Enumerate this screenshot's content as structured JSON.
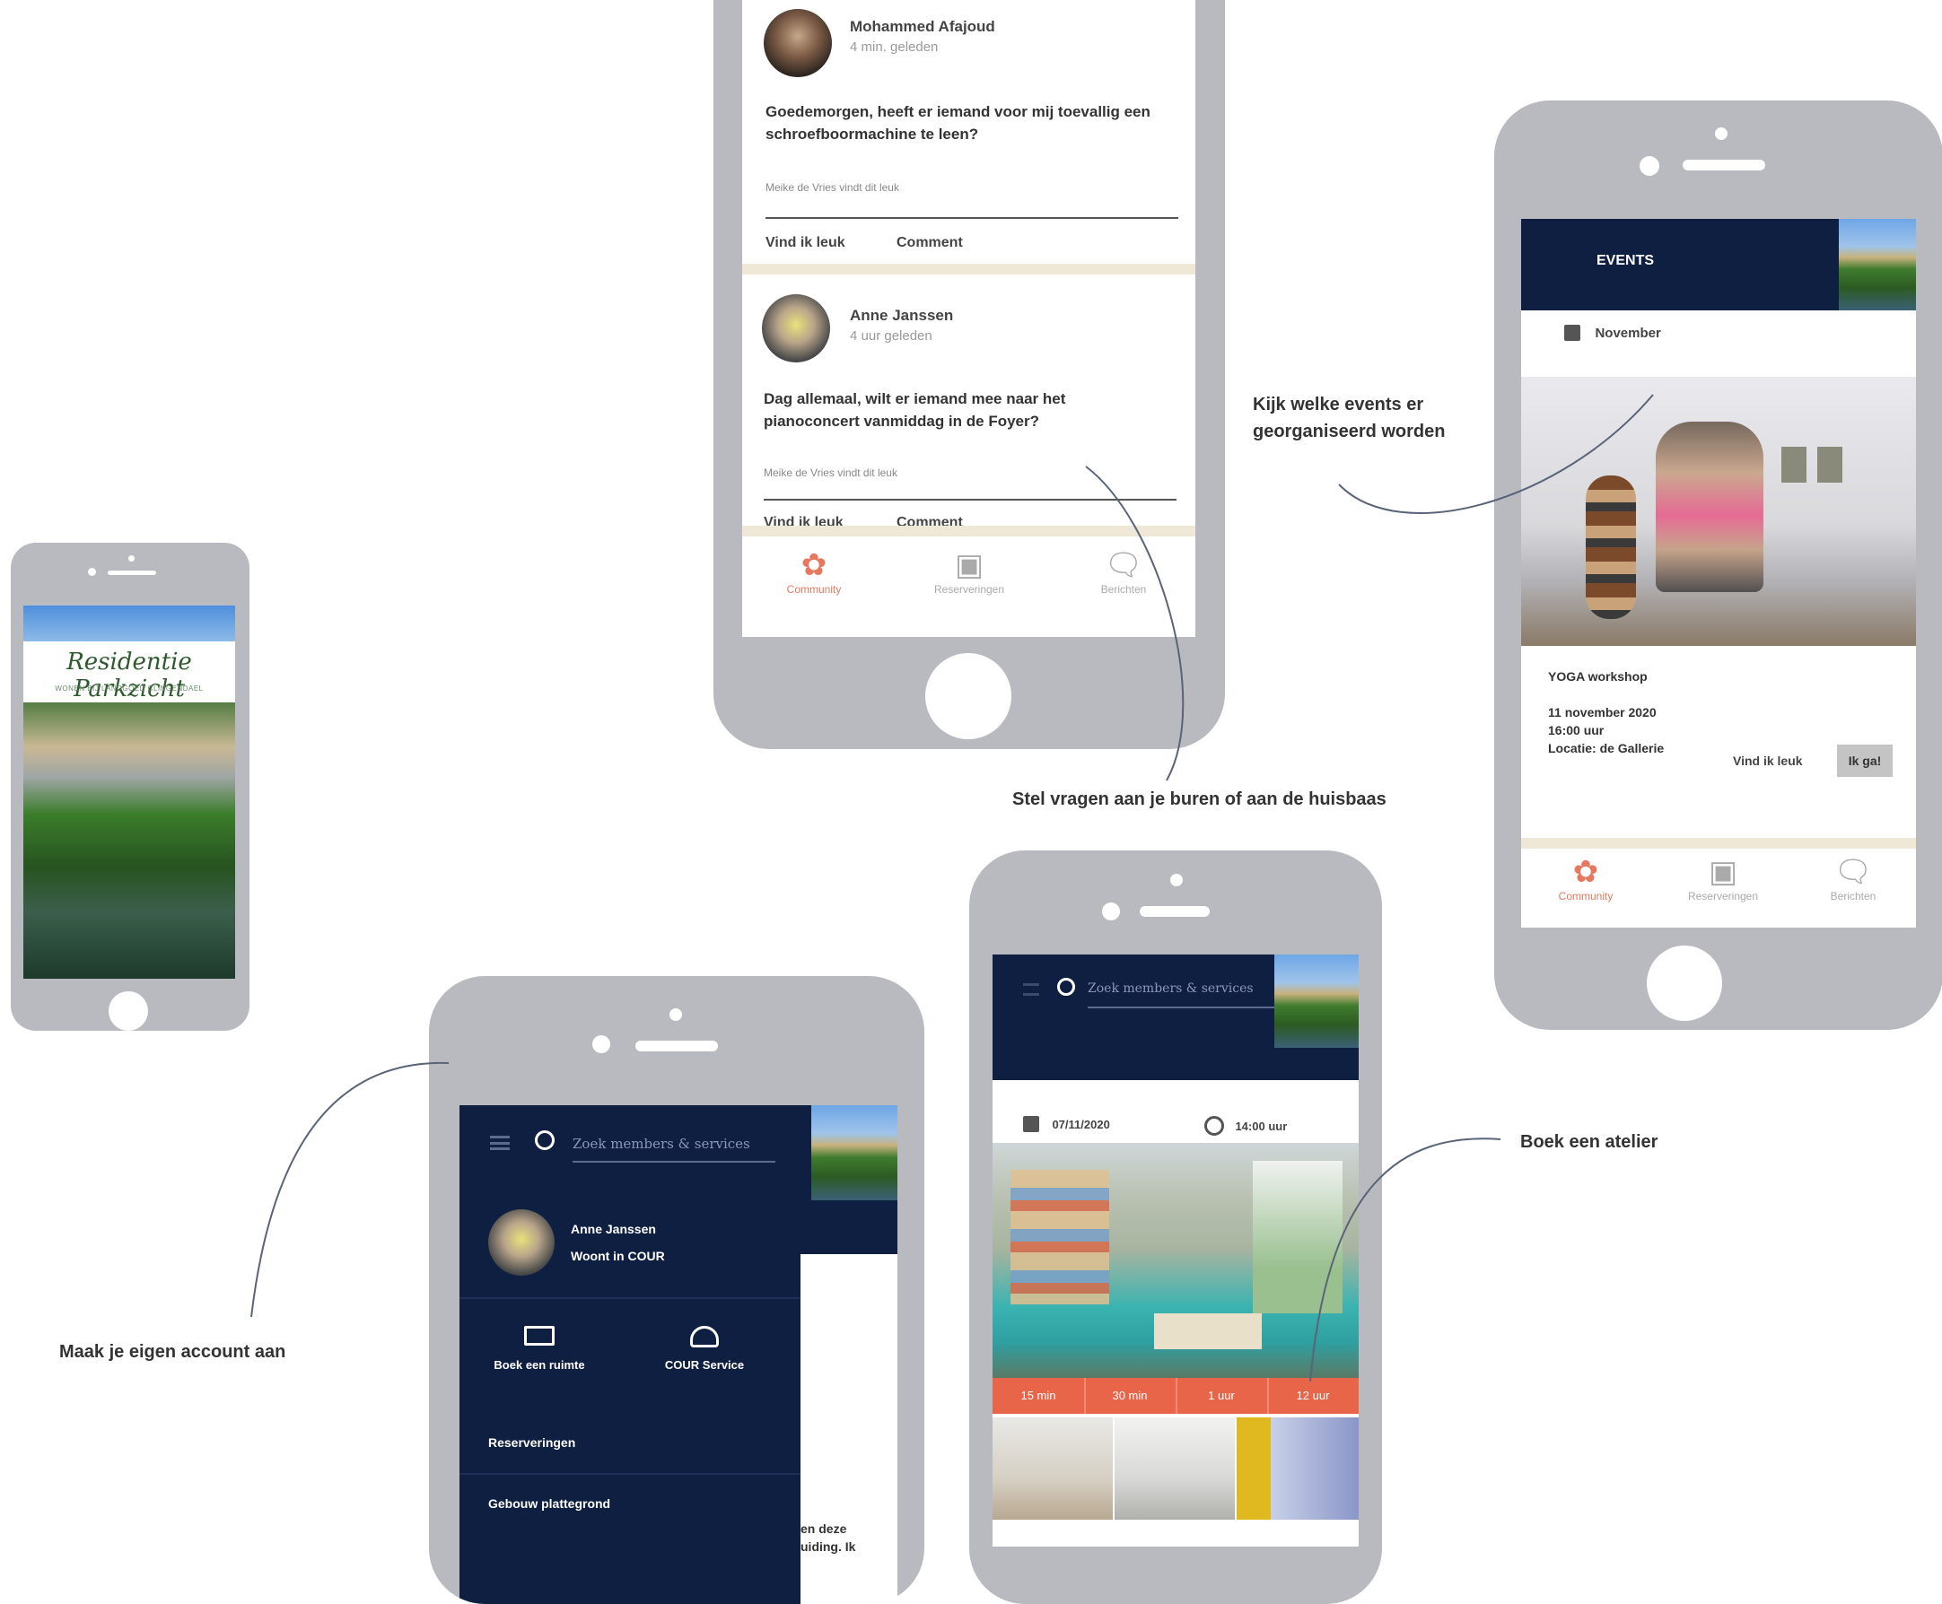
{
  "annotations": {
    "account": "Maak je eigen account aan",
    "questions": "Stel vragen aan je buren of aan de huisbaas",
    "events": "Kijk welke events er georganiseerd worden",
    "studio": "Boek een atelier"
  },
  "splash": {
    "brand_title": "Residentie Parkzicht",
    "brand_subtitle": "WONEN BIJ LANDGOED CLINGENDAEL"
  },
  "feed": {
    "posts": [
      {
        "author": "Mohammed Afajoud",
        "time": "4 min. geleden",
        "text": "Goedemorgen, heeft er iemand voor mij toevallig een schroefboormachine te leen?",
        "likes": "Meike de Vries vindt dit leuk",
        "like_label": "Vind ik leuk",
        "comment_label": "Comment"
      },
      {
        "author": "Anne Janssen",
        "time": "4 uur geleden",
        "text": "Dag allemaal, wilt er iemand mee naar het pianoconcert vanmiddag in de Foyer?",
        "likes": "Meike de Vries vindt dit leuk",
        "like_label": "Vind ik leuk",
        "comment_label": "Comment"
      }
    ]
  },
  "tabs": {
    "community": "Community",
    "reservations": "Reserveringen",
    "messages": "Berichten"
  },
  "events_screen": {
    "header": "EVENTS",
    "month": "November",
    "event_title": "YOGA workshop",
    "event_date": "11 november 2020",
    "event_time": "16:00 uur",
    "event_location": "Locatie: de Gallerie",
    "like_label": "Vind ik leuk",
    "go_label": "Ik ga!"
  },
  "menu_screen": {
    "search_placeholder": "Zoek members & services",
    "user_name": "Anne Janssen",
    "user_status": "Woont in COUR",
    "shortcut_1": "Boek een ruimte",
    "shortcut_2": "COUR Service",
    "menu_1": "Reserveringen",
    "menu_2": "Gebouw plattegrond",
    "peek_text": "en deze uiding. Ik"
  },
  "booking_screen": {
    "search_placeholder": "Zoek members & services",
    "date": "07/11/2020",
    "time": "14:00 uur",
    "slots": [
      "15 min",
      "30 min",
      "1 uur",
      "12 uur"
    ]
  },
  "colors": {
    "navy": "#0f1f42",
    "accent": "#e6785f",
    "slot_bar": "#e8654a",
    "phone_frame": "#b9b9c0",
    "separator": "#efe8d6"
  }
}
